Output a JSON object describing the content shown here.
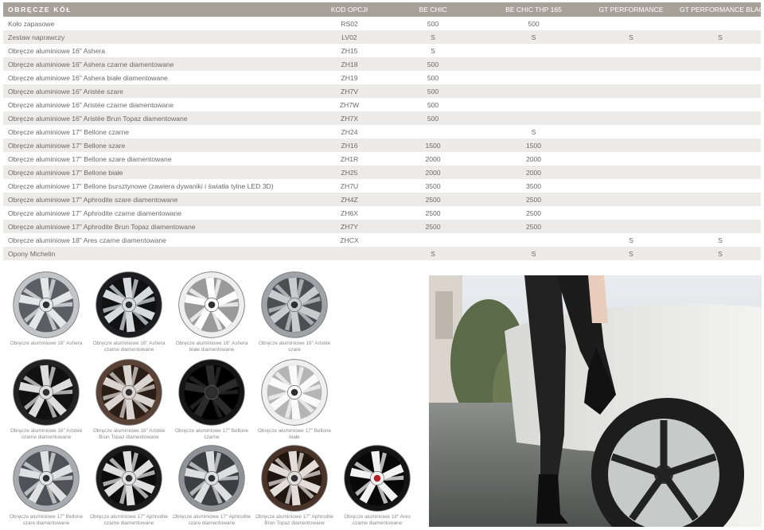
{
  "table": {
    "headers": [
      "OBRĘCZE KÓŁ",
      "KOD OPCJI",
      "BE CHIC",
      "BE CHIC THP 165",
      "GT PERFORMANCE",
      "GT PERFORMANCE BLACK"
    ],
    "rows": [
      [
        "Koło zapasowe",
        "RS02",
        "500",
        "500",
        "",
        ""
      ],
      [
        "Zestaw naprawczy",
        "LV02",
        "S",
        "S",
        "S",
        "S"
      ],
      [
        "Obręcze aluminiowe 16\" Ashera",
        "ZH15",
        "S",
        "",
        "",
        ""
      ],
      [
        "Obręcze aluminiowe 16\" Ashera czarne diamentowane",
        "ZH18",
        "500",
        "",
        "",
        ""
      ],
      [
        "Obręcze aluminiowe 16\" Ashera białe diamentowane",
        "ZH19",
        "500",
        "",
        "",
        ""
      ],
      [
        "Obręcze aluminiowe 16\" Aristée szare",
        "ZH7V",
        "500",
        "",
        "",
        ""
      ],
      [
        "Obręcze aluminiowe 16\" Aristée czarne diamentowane",
        "ZH7W",
        "500",
        "",
        "",
        ""
      ],
      [
        "Obręcze aluminiowe 16\" Aristée Brun Topaz diamentowane",
        "ZH7X",
        "500",
        "",
        "",
        ""
      ],
      [
        "Obręcze aluminiowe 17\" Bellone czarne",
        "ZH24",
        "",
        "S",
        "",
        ""
      ],
      [
        "Obręcze aluminiowe 17\" Bellone szare",
        "ZH16",
        "1500",
        "1500",
        "",
        ""
      ],
      [
        "Obręcze aluminiowe 17\" Bellone szare diamentowane",
        "ZH1R",
        "2000",
        "2000",
        "",
        ""
      ],
      [
        "Obręcze aluminiowe 17\" Bellone białe",
        "ZH25",
        "2000",
        "2000",
        "",
        ""
      ],
      [
        "Obręcze aluminiowe 17\" Bellone bursztynowe (zawiera dywaniki i światła tylne LED 3D)",
        "ZH7U",
        "3500",
        "3500",
        "",
        ""
      ],
      [
        "Obręcze aluminiowe 17\" Aphrodite szare diamentowane",
        "ZH4Z",
        "2500",
        "2500",
        "",
        ""
      ],
      [
        "Obręcze aluminiowe 17\" Aphrodite czarne diamentowane",
        "ZH6X",
        "2500",
        "2500",
        "",
        ""
      ],
      [
        "Obręcze aluminiowe 17\" Aphrodite Brun Topaz diamentowane",
        "ZH7Y",
        "2500",
        "2500",
        "",
        ""
      ],
      [
        "Obręcze aluminiowe 18\" Ares czarne diamentowane",
        "ZHCX",
        "",
        "",
        "S",
        "S"
      ],
      [
        "Opony Michelin",
        "",
        "S",
        "S",
        "S",
        "S"
      ]
    ]
  },
  "wheels": [
    {
      "caption": [
        "Obręcze aluminiowe 16\" Ashera"
      ],
      "rim": "#c2c5c8",
      "spoke": "#e4e6e8",
      "gap": "#5b5f63"
    },
    {
      "caption": [
        "Obręcze aluminiowe 16\" Ashera",
        "czarne diamentowane"
      ],
      "rim": "#1d1d1f",
      "spoke": "#d8dadc",
      "gap": "#111"
    },
    {
      "caption": [
        "Obręcze aluminiowe 16\" Ashera",
        "białe diamentowane"
      ],
      "rim": "#eeeeee",
      "spoke": "#ffffff",
      "gap": "#9a9a9a"
    },
    {
      "caption": [
        "Obręcze aluminiowe 16\" Aristée",
        "szare"
      ],
      "rim": "#9fa3a7",
      "spoke": "#c9cccf",
      "gap": "#4c4f52"
    },
    {
      "caption": [
        "Obręcze aluminiowe 16\" Aristée",
        "czarne diamentowane"
      ],
      "rim": "#222",
      "spoke": "#dcdcdc",
      "gap": "#111"
    },
    {
      "caption": [
        "Obręcze aluminiowe 16\" Aristée",
        "Brun Topaz diamentowane"
      ],
      "rim": "#5a4236",
      "spoke": "#d9d4cf",
      "gap": "#2a1d16"
    },
    {
      "caption": [
        "Obręcze aluminiowe 17\" Bellone",
        "czarne"
      ],
      "rim": "#151515",
      "spoke": "#2b2b2b",
      "gap": "#000"
    },
    {
      "caption": [
        "Obręcze aluminiowe 17\" Bellone",
        "białe"
      ],
      "rim": "#f0f0f0",
      "spoke": "#fafafa",
      "gap": "#b5b5b5"
    },
    {
      "caption": [
        "Obręcze aluminiowe 17\" Bellone",
        "szare diamentowane"
      ],
      "rim": "#a7abaf",
      "spoke": "#dfe1e3",
      "gap": "#4f5357"
    },
    {
      "caption": [
        "Obręcze aluminiowe 17\" Aphrodite",
        "czarne diamentowane"
      ],
      "rim": "#1b1b1b",
      "spoke": "#e0e0e0",
      "gap": "#0d0d0d"
    },
    {
      "caption": [
        "Obręcze aluminiowe 17\" Aphrodite",
        "szare diamentowane"
      ],
      "rim": "#8f9397",
      "spoke": "#dcdee0",
      "gap": "#3c3f42"
    },
    {
      "caption": [
        "Obręcze aluminiowe 17\" Aphrodite",
        "Brun Topaz diamentowane"
      ],
      "rim": "#4a3328",
      "spoke": "#e2ddd8",
      "gap": "#21150f"
    },
    {
      "caption": [
        "Obręcze aluminiowe 18\" Ares",
        "czarne diamentowane"
      ],
      "rim": "#141414",
      "spoke": "#f2f2f2",
      "gap": "#080808",
      "hub": "#b0202a"
    }
  ]
}
